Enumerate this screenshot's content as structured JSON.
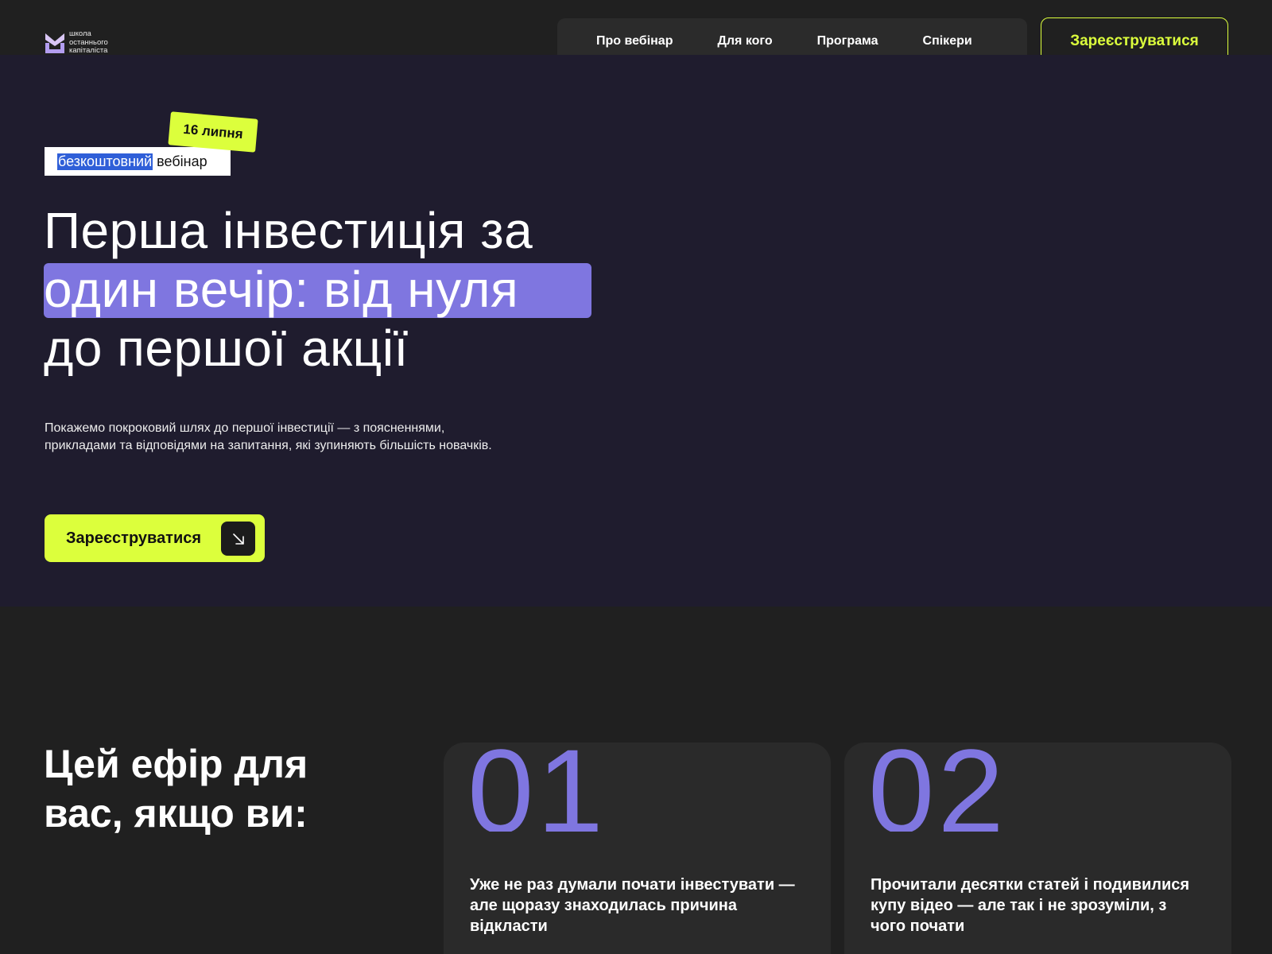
{
  "header": {
    "logo_lines": [
      "школа",
      "останнього",
      "капіталіста"
    ],
    "nav": [
      "Про вебінар",
      "Для кого",
      "Програма",
      "Спікери"
    ],
    "cta_label": "Зареєструватися"
  },
  "hero": {
    "date_badge": "16 липня",
    "tag_selected": "безкоштовний",
    "tag_rest": "вебінар",
    "title_line_1": "Перша інвестиція за",
    "title_line_2": "один вечір: від нуля",
    "title_line_3": "до першої акції",
    "description": "Покажемо покроковий шлях до першої інвестиції — з поясненнями, прикладами та відповідями на запитання, які зупиняють більшість новачків.",
    "cta_label": "Зареєструватися",
    "cta_icon": "arrow-down-right-icon"
  },
  "audience": {
    "title": "Цей ефір для вас, якщо ви:",
    "cards": [
      {
        "number": "01",
        "text": "Уже не раз думали почати інвестувати — але щоразу знаходилась причина відкласти"
      },
      {
        "number": "02",
        "text": "Прочитали десятки статей і подивилися купу відео — але так і не зрозуміли, з чого почати"
      }
    ]
  },
  "colors": {
    "accent_lime": "#dcff3c",
    "accent_purple": "#7f76e0",
    "hero_bg": "#1f1c2e",
    "page_bg": "#202020",
    "card_bg": "#2a2a2a"
  }
}
